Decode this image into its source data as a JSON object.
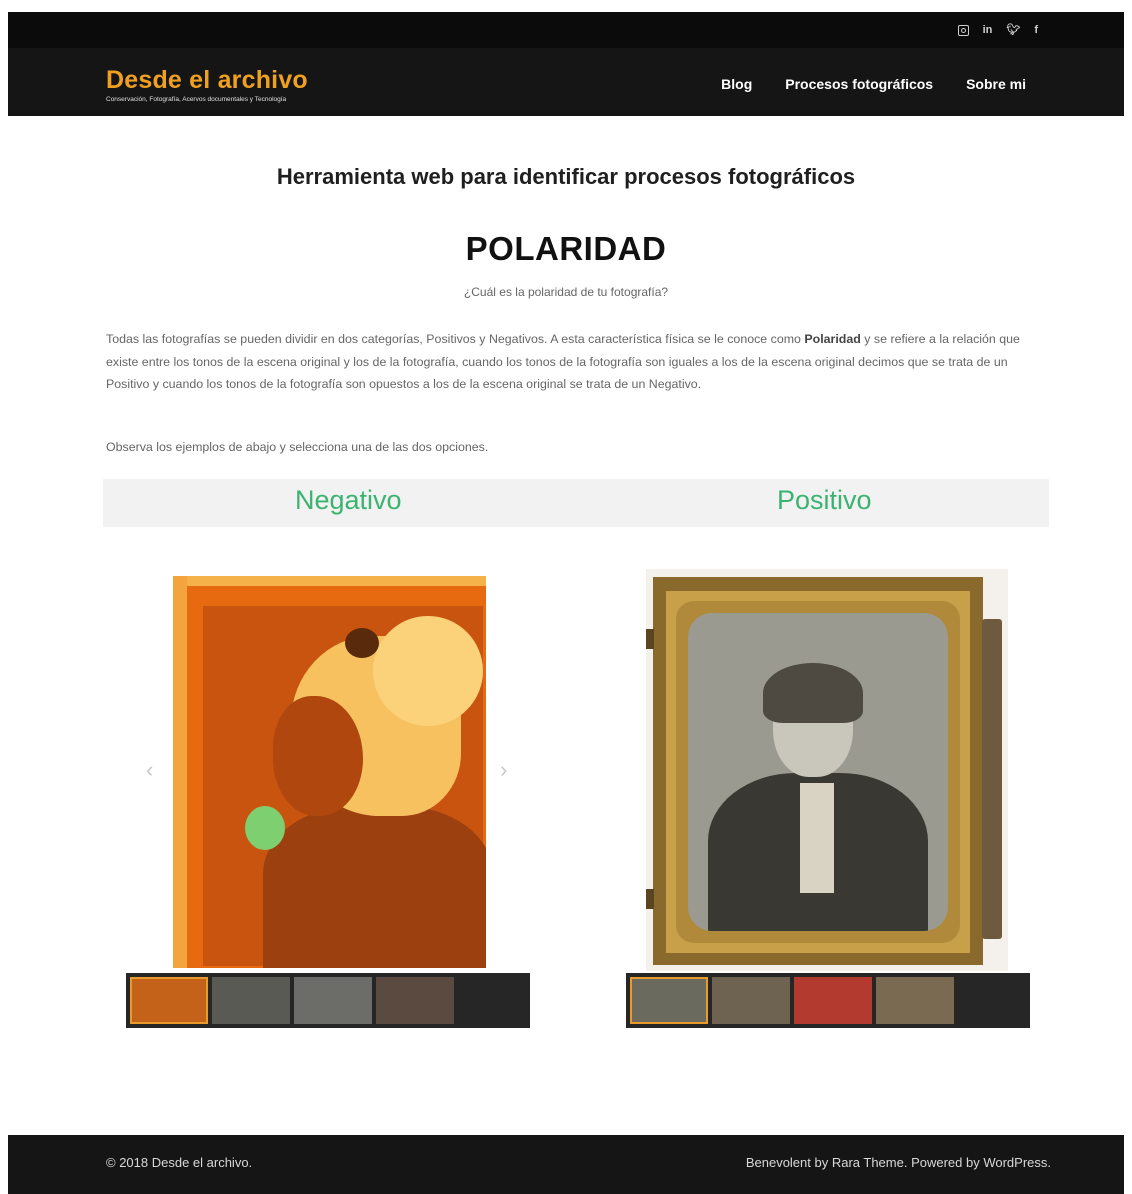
{
  "topbar": {
    "social": [
      {
        "icon": "instagram-icon",
        "label": ""
      },
      {
        "icon": "linkedin-icon",
        "label": "in"
      },
      {
        "icon": "twitter-icon",
        "label": "♥"
      },
      {
        "icon": "facebook-icon",
        "label": "f"
      }
    ]
  },
  "header": {
    "site_title": "Desde el archivo",
    "tagline": "Conservación, Fotografía, Acervos documentales y Tecnología",
    "nav": [
      "Blog",
      "Procesos fotográficos",
      "Sobre mi"
    ]
  },
  "content": {
    "tool_title": "Herramienta web para identificar procesos fotográficos",
    "section_title": "POLARIDAD",
    "question": "¿Cuál es la polaridad de tu fotografía?",
    "intro_before_bold": "Todas las fotografías se pueden dividir en dos categorías, Positivos y Negativos. A esta característica física se le conoce como ",
    "intro_bold": "Polaridad",
    "intro_after_bold": " y se refiere a la relación que existe entre los tonos de la escena original y los de la fotografía, cuando los tonos de la fotografía son iguales a los de la escena original decimos que se trata de un Positivo y cuando los tonos de la fotografía son opuestos a los de la escena original se trata de un Negativo.",
    "instruction": "Observa los ejemplos de abajo y selecciona una de las dos opciones.",
    "option_negative": "Negativo",
    "option_positive": "Positivo",
    "arrow_prev": "‹",
    "arrow_next": "›"
  },
  "galleries": {
    "negative_thumbs": [
      "#c5621a",
      "#5a5a55",
      "#6c6c68",
      "#5b4a40"
    ],
    "positive_thumbs": [
      "#6a6a5f",
      "#6e6250",
      "#b23a2e",
      "#7a6a52"
    ]
  },
  "footer": {
    "copyright": "© 2018 Desde el archivo.",
    "credits": "Benevolent by Rara Theme. Powered by WordPress."
  }
}
